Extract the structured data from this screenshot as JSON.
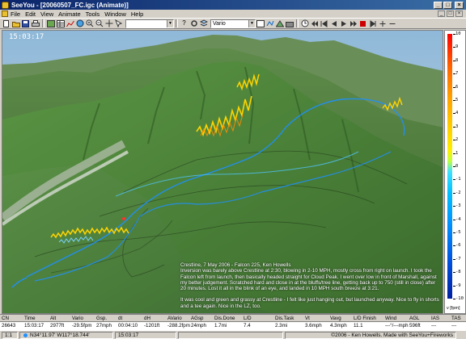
{
  "window": {
    "title": "SeeYou - [20060507_FC.igc (Animate)]",
    "controls": [
      "_",
      "□",
      "×"
    ]
  },
  "menu": [
    "File",
    "Edit",
    "View",
    "Animate",
    "Tools",
    "Window",
    "Help"
  ],
  "toolbar": {
    "pilot_select": "Vario",
    "time_select": ""
  },
  "viewport": {
    "time": "15:03:17",
    "caption": [
      "Crestline, 7 May 2006 - Falcon 225, Ken Howells",
      "Inversion was barely above Crestline at 2:30, blowing in 2-10 MPH, mostly cross from right on launch. I took the Falcon left from launch, then basically headed straight for Cloud Peak. I went over low in front of Marshall, against my better judgement. Scratched hard and close in at the bluffs/tree line, getting back up to 750 (still in close) after 20 minutes. Lost it all in the blink of an eye, and landed in 10 MPH south breeze at 3:21.",
      "It was cool and green and grassy at Crestline - I felt like just hanging out, but launched anyway. Nice to fly in shorts and a tee again. Nice in the LZ, too."
    ]
  },
  "scale": {
    "ticks": [
      "10",
      "9",
      "8",
      "7",
      "6",
      "5",
      "4",
      "3",
      "2",
      "1",
      "0",
      "-1",
      "-2",
      "-3",
      "-4",
      "-5",
      "-6",
      "-7",
      "-8",
      "-9",
      "-10"
    ],
    "unit": "v [fpm]"
  },
  "table": {
    "headers": [
      "CN",
      "Time",
      "Alt",
      "Vario",
      "Gsp.",
      "dt",
      "dH",
      "AVario",
      "AGsp",
      "Dis.Done",
      "L/D",
      "Dis.Task",
      "Vt",
      "Vavg",
      "L/D Finish",
      "Wind",
      "AGL",
      "IAS",
      "TAS"
    ],
    "values": [
      "26643",
      "15:03:17",
      "2977ft",
      "-29.5fpm",
      "27mph",
      "00:04:10",
      "-1201ft",
      "-288.2fpm",
      "24mph",
      "1.7mi",
      "7.4",
      "2.3mi",
      "3.6mph",
      "4.3mph",
      "11.1",
      "---°/---mph",
      "596ft",
      "---",
      "---"
    ]
  },
  "statusbar": {
    "zoom": "1:1",
    "coords": "N34°11.97'  W117°18.744'",
    "time": "15:03:17",
    "copyright": "©2006 - Ken Howells. Made with SeeYou+Fireworks"
  },
  "colors": {
    "titlebar": "#0a246a",
    "track_low": "#1e90ff",
    "track_high": "#ffd700",
    "terrain": "#4c8a3c"
  }
}
